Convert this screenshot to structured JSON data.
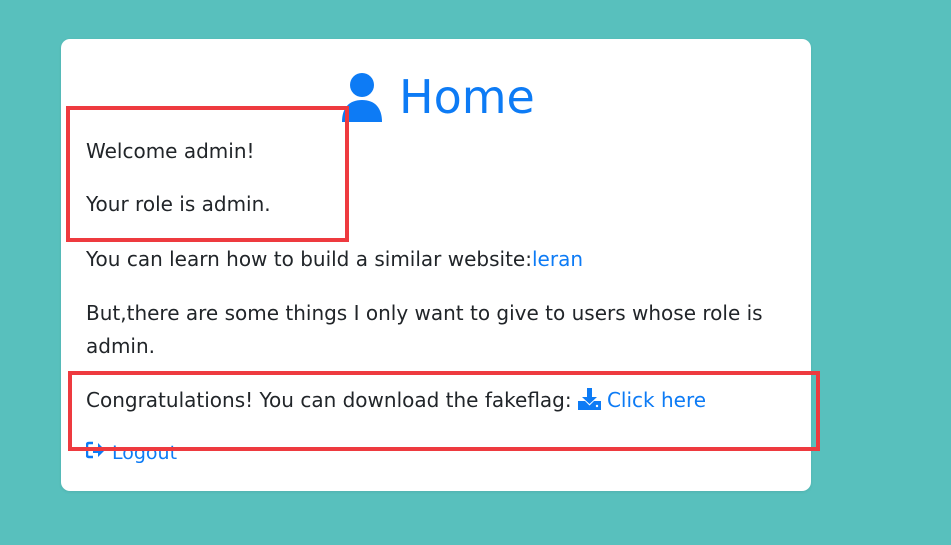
{
  "header": {
    "icon": "user-icon",
    "title": "Home"
  },
  "welcome_text": "Welcome admin!",
  "role_text": "Your role is admin.",
  "learn": {
    "prefix": "You can learn how to build a similar website:",
    "link_label": "leran"
  },
  "admin_note": "But,there are some things I only want to give to users whose role is admin.",
  "download": {
    "prefix": "Congratulations! You can download the fakeflag: ",
    "icon": "download-icon",
    "link_label": "Click here"
  },
  "logout": {
    "icon": "sign-out-icon",
    "label": "Logout"
  },
  "colors": {
    "background": "#58c0bd",
    "link": "#0d7bf5",
    "highlight": "#ee3a3f",
    "text": "#212529"
  }
}
